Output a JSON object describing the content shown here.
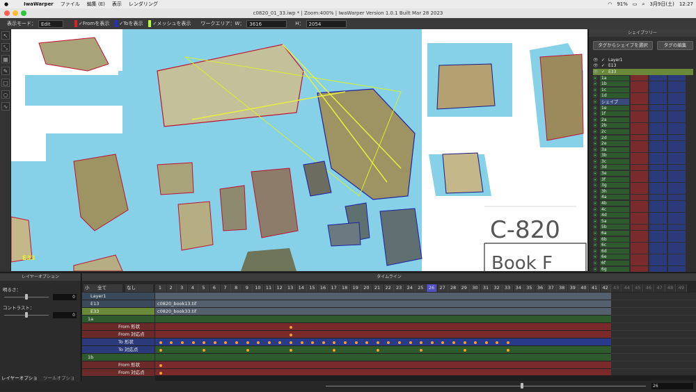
{
  "menubar": {
    "app": "IwaWarper",
    "items": [
      "ファイル",
      "編集 (E)",
      "表示",
      "レンダリング"
    ],
    "battery": "91%",
    "date": "3月9日(土)",
    "time": "12:27"
  },
  "window": {
    "title": "c0820_01_33.iwp * | Zoom:400% | IwaWarper Version 1.0.1  Built Mar 28 2023"
  },
  "toolbar": {
    "mode_label": "表示モード：",
    "mode_value": "Edit",
    "from_label": "Fromを表示",
    "to_label": "Toを表示",
    "mesh_label": "メッシュを表示",
    "work_area_label": "ワークエリア：W：",
    "width_value": "3616",
    "height_label": "H：",
    "height_value": "2054",
    "colors": {
      "from": "#e02020",
      "to": "#2030d0",
      "mesh": "#b8ff30"
    }
  },
  "canvas": {
    "layer_tag": "E33",
    "handwriting": "C-820",
    "handwriting2": "Book F"
  },
  "shape_tree": {
    "header": "シェイプツリー",
    "btn_select_by_tag": "タグからシェイプを選択",
    "btn_edit_tags": "タグの編集",
    "layers": [
      "Layer1",
      "E13",
      "E33"
    ],
    "shapes": [
      "1a",
      "1b",
      "1c",
      "1d",
      "シェイプ",
      "1e",
      "1f",
      "2a",
      "2b",
      "2c",
      "2d",
      "2e",
      "3a",
      "3b",
      "3c",
      "3d",
      "3e",
      "3f",
      "3g",
      "3h",
      "4a",
      "4b",
      "4c",
      "4d",
      "5a",
      "5b",
      "6a",
      "6b",
      "6c",
      "6d",
      "6e",
      "6f",
      "6g"
    ]
  },
  "layer_options": {
    "header": "レイヤーオプション",
    "brightness_label": "明るさ：",
    "brightness_value": "0",
    "contrast_label": "コントラスト：",
    "contrast_value": "0",
    "tab_layer": "レイヤーオプショ",
    "tab_tool": "ツールオプショ"
  },
  "timeline": {
    "header": "タイムライン",
    "size_select": "小",
    "filter_select": "全て",
    "tag_select": "なし",
    "frames": [
      1,
      2,
      3,
      4,
      5,
      6,
      7,
      8,
      9,
      10,
      11,
      12,
      13,
      14,
      15,
      16,
      17,
      18,
      19,
      20,
      21,
      22,
      23,
      24,
      25,
      26,
      27,
      28,
      29,
      30,
      31,
      32,
      33,
      34,
      35,
      36,
      37,
      38,
      39,
      40,
      41,
      42,
      43,
      44,
      45,
      46,
      47,
      48,
      49
    ],
    "current_frame": 26,
    "active_end": 42,
    "layer_rows": [
      {
        "name": "Layer1",
        "cell": ""
      },
      {
        "name": "E13",
        "cell": "c0820_book13.tif"
      },
      {
        "name": "E33",
        "cell": "c0820_book33.tif"
      }
    ],
    "shape_1a": "1a",
    "from_shape": "From 形状",
    "from_corr": "From 対応点",
    "to_shape": "To 形状",
    "to_corr": "To 対応点",
    "shape_1b": "1b",
    "frame_input": "26",
    "key_frames_from": [
      13
    ],
    "key_frames_to": [
      1,
      2,
      3,
      4,
      5,
      6,
      7,
      8,
      9,
      10,
      11,
      12,
      13,
      14,
      15,
      16,
      17,
      18,
      19,
      20,
      21,
      22,
      23,
      24,
      25,
      26,
      27,
      28,
      29,
      30,
      31,
      32,
      33
    ],
    "key_frames_to_corr": [
      1,
      5,
      9,
      13,
      17,
      21,
      25,
      29,
      33
    ]
  }
}
